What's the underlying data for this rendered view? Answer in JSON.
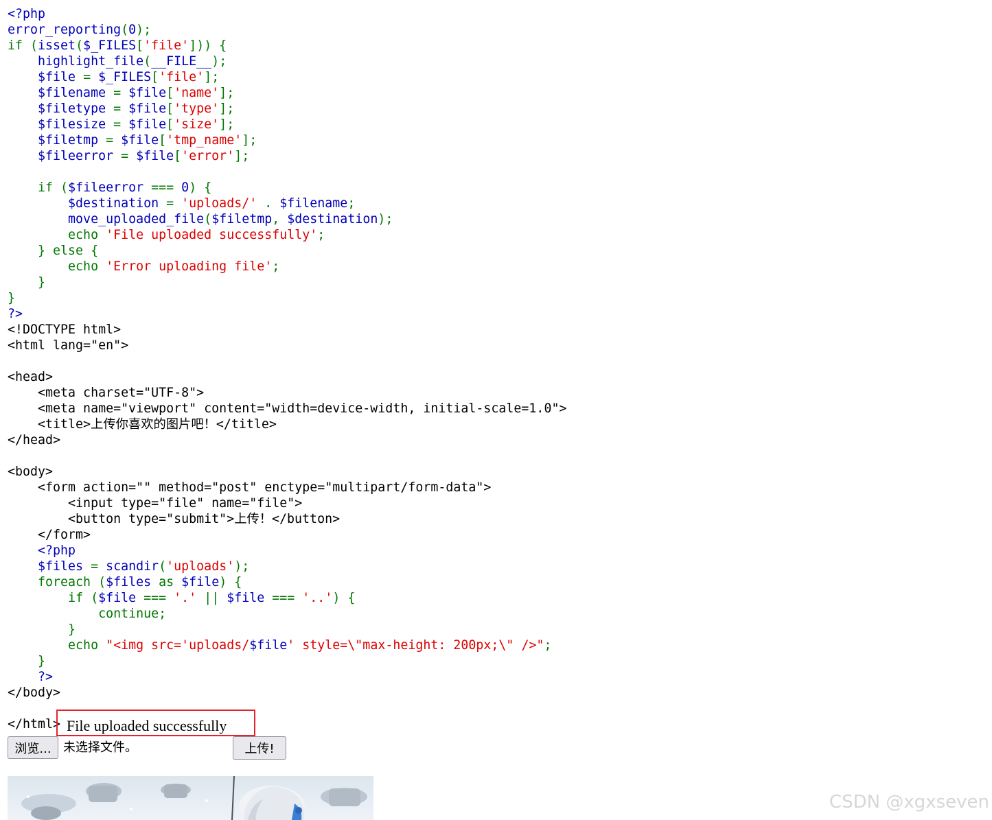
{
  "source_lines": [
    [
      [
        "d",
        "<?php"
      ]
    ],
    [
      [
        "d",
        "error_reporting"
      ],
      [
        "k",
        "("
      ],
      [
        "d",
        "0"
      ],
      [
        "k",
        ");"
      ]
    ],
    [
      [
        "k",
        "if ("
      ],
      [
        "d",
        "isset"
      ],
      [
        "k",
        "("
      ],
      [
        "d",
        "$_FILES"
      ],
      [
        "k",
        "["
      ],
      [
        "s",
        "'file'"
      ],
      [
        "k",
        "])) {"
      ]
    ],
    [
      [
        "d",
        "    highlight_file"
      ],
      [
        "k",
        "("
      ],
      [
        "d",
        "__FILE__"
      ],
      [
        "k",
        ");"
      ]
    ],
    [
      [
        "d",
        "    $file "
      ],
      [
        "k",
        "= "
      ],
      [
        "d",
        "$_FILES"
      ],
      [
        "k",
        "["
      ],
      [
        "s",
        "'file'"
      ],
      [
        "k",
        "];"
      ]
    ],
    [
      [
        "d",
        "    $filename "
      ],
      [
        "k",
        "= "
      ],
      [
        "d",
        "$file"
      ],
      [
        "k",
        "["
      ],
      [
        "s",
        "'name'"
      ],
      [
        "k",
        "];"
      ]
    ],
    [
      [
        "d",
        "    $filetype "
      ],
      [
        "k",
        "= "
      ],
      [
        "d",
        "$file"
      ],
      [
        "k",
        "["
      ],
      [
        "s",
        "'type'"
      ],
      [
        "k",
        "];"
      ]
    ],
    [
      [
        "d",
        "    $filesize "
      ],
      [
        "k",
        "= "
      ],
      [
        "d",
        "$file"
      ],
      [
        "k",
        "["
      ],
      [
        "s",
        "'size'"
      ],
      [
        "k",
        "];"
      ]
    ],
    [
      [
        "d",
        "    $filetmp "
      ],
      [
        "k",
        "= "
      ],
      [
        "d",
        "$file"
      ],
      [
        "k",
        "["
      ],
      [
        "s",
        "'tmp_name'"
      ],
      [
        "k",
        "];"
      ]
    ],
    [
      [
        "d",
        "    $fileerror "
      ],
      [
        "k",
        "= "
      ],
      [
        "d",
        "$file"
      ],
      [
        "k",
        "["
      ],
      [
        "s",
        "'error'"
      ],
      [
        "k",
        "];"
      ]
    ],
    [],
    [
      [
        "k",
        "    if ("
      ],
      [
        "d",
        "$fileerror "
      ],
      [
        "k",
        "=== "
      ],
      [
        "d",
        "0"
      ],
      [
        "k",
        ") {"
      ]
    ],
    [
      [
        "d",
        "        $destination "
      ],
      [
        "k",
        "= "
      ],
      [
        "s",
        "'uploads/' "
      ],
      [
        "k",
        ". "
      ],
      [
        "d",
        "$filename"
      ],
      [
        "k",
        ";"
      ]
    ],
    [
      [
        "d",
        "        move_uploaded_file"
      ],
      [
        "k",
        "("
      ],
      [
        "d",
        "$filetmp"
      ],
      [
        "k",
        ", "
      ],
      [
        "d",
        "$destination"
      ],
      [
        "k",
        ");"
      ]
    ],
    [
      [
        "k",
        "        echo "
      ],
      [
        "s",
        "'File uploaded successfully'"
      ],
      [
        "k",
        ";"
      ]
    ],
    [
      [
        "k",
        "    } else {"
      ]
    ],
    [
      [
        "k",
        "        echo "
      ],
      [
        "s",
        "'Error uploading file'"
      ],
      [
        "k",
        ";"
      ]
    ],
    [
      [
        "k",
        "    }"
      ]
    ],
    [
      [
        "k",
        "}"
      ]
    ],
    [
      [
        "d",
        "?>"
      ]
    ],
    [
      [
        "h",
        "<!DOCTYPE html>"
      ]
    ],
    [
      [
        "h",
        "<html lang=\"en\">"
      ]
    ],
    [],
    [
      [
        "h",
        "<head>"
      ]
    ],
    [
      [
        "h",
        "    <meta charset=\"UTF-8\">"
      ]
    ],
    [
      [
        "h",
        "    <meta name=\"viewport\" content=\"width=device-width, initial-scale=1.0\">"
      ]
    ],
    [
      [
        "h",
        "    <title>"
      ],
      [
        "c",
        "上传你喜欢的图片吧！"
      ],
      [
        "h",
        "</title>"
      ]
    ],
    [
      [
        "h",
        "</head>"
      ]
    ],
    [],
    [
      [
        "h",
        "<body>"
      ]
    ],
    [
      [
        "h",
        "    <form action=\"\" method=\"post\" enctype=\"multipart/form-data\">"
      ]
    ],
    [
      [
        "h",
        "        <input type=\"file\" name=\"file\">"
      ]
    ],
    [
      [
        "h",
        "        <button type=\"submit\">"
      ],
      [
        "c",
        "上传！"
      ],
      [
        "h",
        "</button>"
      ]
    ],
    [
      [
        "h",
        "    </form>"
      ]
    ],
    [
      [
        "d",
        "    <?php"
      ]
    ],
    [
      [
        "d",
        "    $files "
      ],
      [
        "k",
        "= "
      ],
      [
        "d",
        "scandir"
      ],
      [
        "k",
        "("
      ],
      [
        "s",
        "'uploads'"
      ],
      [
        "k",
        ");"
      ]
    ],
    [
      [
        "k",
        "    foreach ("
      ],
      [
        "d",
        "$files "
      ],
      [
        "k",
        "as "
      ],
      [
        "d",
        "$file"
      ],
      [
        "k",
        ") {"
      ]
    ],
    [
      [
        "k",
        "        if ("
      ],
      [
        "d",
        "$file "
      ],
      [
        "k",
        "=== "
      ],
      [
        "s",
        "'.' "
      ],
      [
        "k",
        "|| "
      ],
      [
        "d",
        "$file "
      ],
      [
        "k",
        "=== "
      ],
      [
        "s",
        "'..'"
      ],
      [
        "k",
        ") {"
      ]
    ],
    [
      [
        "k",
        "            continue;"
      ]
    ],
    [
      [
        "k",
        "        }"
      ]
    ],
    [
      [
        "k",
        "        echo "
      ],
      [
        "s",
        "\"<img src='uploads/"
      ],
      [
        "d",
        "$file"
      ],
      [
        "s",
        "' style=\\\"max-height: 200px;\\\" />\""
      ],
      [
        "k",
        ";"
      ]
    ],
    [
      [
        "k",
        "    }"
      ]
    ],
    [
      [
        "d",
        "    ?>"
      ]
    ],
    [
      [
        "h",
        "</body>"
      ]
    ],
    [],
    [
      [
        "h",
        "</html>"
      ]
    ]
  ],
  "upload_result": "File uploaded successfully",
  "form": {
    "browse_label": "浏览...",
    "no_file_text": "未选择文件。",
    "submit_label": "上传!"
  },
  "watermark": "CSDN @xgxseven",
  "colors": {
    "php_default": "#0000bb",
    "php_keyword": "#007700",
    "php_string": "#dd0000",
    "html": "#000000",
    "highlight_border": "#e0242c"
  }
}
